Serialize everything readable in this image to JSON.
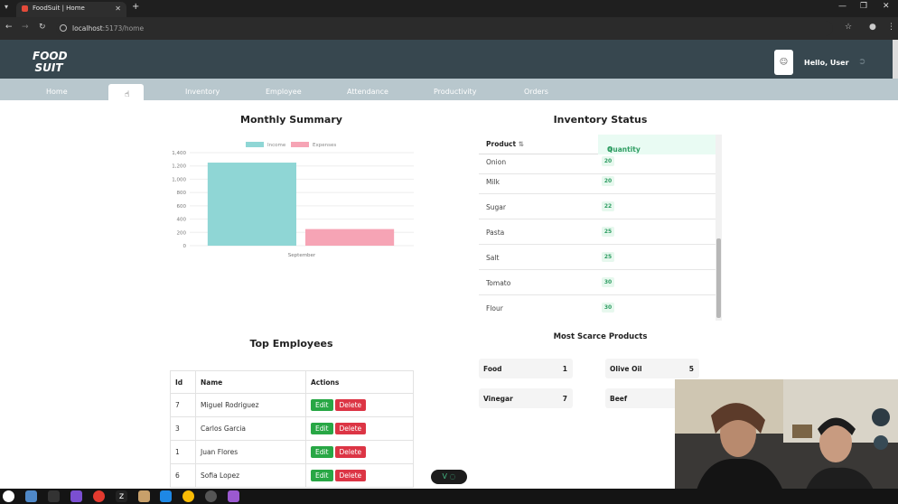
{
  "browser": {
    "tab_title": "FoodSuit | Home",
    "close_glyph": "✕",
    "new_tab_glyph": "+",
    "menu_glyph": "▾",
    "url_host": "localhost",
    "url_rest": ":5173/home",
    "window_controls": [
      "—",
      "❐",
      "✕"
    ]
  },
  "header": {
    "logo_line1": "FOOD",
    "logo_line2": "SUIT",
    "greeting": "Hello, User",
    "avatar_icon": "user-icon",
    "logout_icon": "logout-icon"
  },
  "nav": {
    "items": [
      {
        "label": "Home"
      },
      {
        "label": ""
      },
      {
        "label": "Inventory"
      },
      {
        "label": "Employee"
      },
      {
        "label": "Attendance"
      },
      {
        "label": "Productivity"
      },
      {
        "label": "Orders"
      }
    ]
  },
  "monthly_summary": {
    "title": "Monthly Summary"
  },
  "chart_data": {
    "type": "bar",
    "categories": [
      "September"
    ],
    "series": [
      {
        "name": "Income",
        "values": [
          1250
        ],
        "color": "#8fd6d5"
      },
      {
        "name": "Expenses",
        "values": [
          250
        ],
        "color": "#f6a4b5"
      }
    ],
    "yticks": [
      "1,400",
      "1,200",
      "1,000",
      "800",
      "600",
      "400",
      "200",
      "0"
    ],
    "ylim": [
      0,
      1400
    ],
    "legend_position": "top",
    "grid": true
  },
  "inventory": {
    "title": "Inventory Status",
    "col_product": "Product",
    "col_quantity": "Quantity",
    "sort_icon": "⇅",
    "partial_row": {
      "name": "Onion",
      "qty": "20"
    },
    "rows": [
      {
        "name": "Milk",
        "qty": "20"
      },
      {
        "name": "Sugar",
        "qty": "22"
      },
      {
        "name": "Pasta",
        "qty": "25"
      },
      {
        "name": "Salt",
        "qty": "25"
      },
      {
        "name": "Tomato",
        "qty": "30"
      },
      {
        "name": "Flour",
        "qty": "30"
      }
    ]
  },
  "scarce": {
    "title": "Most Scarce Products",
    "items": [
      {
        "name": "Food",
        "count": "1"
      },
      {
        "name": "Olive Oil",
        "count": "5"
      },
      {
        "name": "Vinegar",
        "count": "7"
      },
      {
        "name": "Beef",
        "count": ""
      }
    ]
  },
  "employees": {
    "title": "Top Employees",
    "headers": [
      "Id",
      "Name",
      "Actions"
    ],
    "edit_label": "Edit",
    "delete_label": "Delete",
    "rows": [
      {
        "id": "7",
        "name": "Miguel Rodriguez"
      },
      {
        "id": "3",
        "name": "Carlos Garcia"
      },
      {
        "id": "1",
        "name": "Juan Flores"
      },
      {
        "id": "6",
        "name": "Sofia Lopez"
      }
    ]
  },
  "devtools": {
    "label": "V"
  }
}
